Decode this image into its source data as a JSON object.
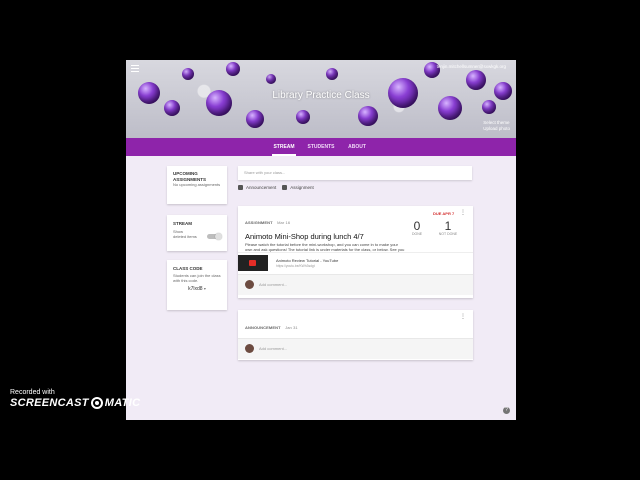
{
  "header": {
    "user_email": "tenjin.mitchellsumner@sxwkgk.org",
    "class_title": "Library Practice Class",
    "theme_link": "Select theme",
    "upload_link": "Upload photo"
  },
  "tabs": [
    {
      "label": "STREAM",
      "active": true
    },
    {
      "label": "STUDENTS",
      "active": false
    },
    {
      "label": "ABOUT",
      "active": false
    }
  ],
  "sidebar": {
    "upcoming": {
      "title": "UPCOMING ASSIGNMENTS",
      "text": "No upcoming assignments"
    },
    "stream": {
      "title": "STREAM",
      "text": "Show deleted items"
    },
    "class_code": {
      "title": "CLASS CODE",
      "text": "Students can join the class with this code.",
      "code": "k7lxd8"
    }
  },
  "share": {
    "placeholder": "Share with your class...",
    "announcement_label": "Announcement",
    "assignment_label": "Assignment"
  },
  "posts": {
    "assignment": {
      "type_label": "ASSIGNMENT",
      "date": "Mar 16",
      "due": "DUE APR 7",
      "title": "Animoto Mini-Shop during lunch 4/7",
      "body": "Please watch the tutorial before the mini-workshop, and you can come in to make your own and ask questions! The tutorial link is under materials for the class, or below. See you there!",
      "done_count": "0",
      "done_label": "DONE",
      "not_done_count": "1",
      "not_done_label": "NOT DONE",
      "attachment_title": "Animoto Review Tutorial - YouTube",
      "attachment_url": "https://youtu.be/KWh3sdgt",
      "comment_placeholder": "Add comment..."
    },
    "announcement": {
      "type_label": "ANNOUNCEMENT",
      "date": "Jan 31",
      "body": "This is a test class",
      "comment_placeholder": "Add comment..."
    }
  },
  "watermark": {
    "small": "Recorded with",
    "brand_left": "SCREENCAST",
    "brand_right": "MATIC"
  },
  "colors": {
    "tab_bar": "#8e24aa",
    "page_bg": "#f1ebf6",
    "due": "#d32f2f"
  }
}
